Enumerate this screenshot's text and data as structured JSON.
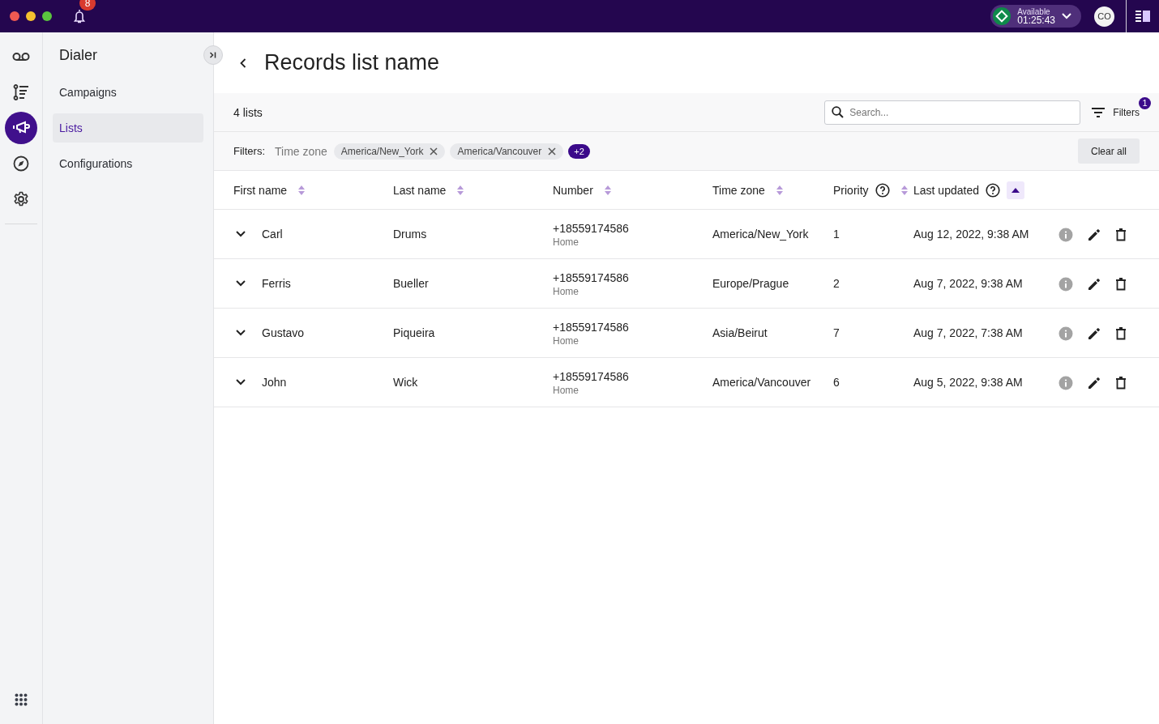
{
  "topbar": {
    "notification_count": "8",
    "status": {
      "label": "Available",
      "timer": "01:25:43"
    },
    "avatar": "CO"
  },
  "rail": [
    {
      "kind": "voicemail",
      "selected": false
    },
    {
      "kind": "list",
      "selected": false
    },
    {
      "kind": "campaign",
      "selected": true
    },
    {
      "kind": "compass",
      "selected": false
    },
    {
      "kind": "settings",
      "selected": false
    }
  ],
  "sidebar": {
    "title": "Dialer",
    "items": [
      {
        "label": "Campaigns",
        "selected": false
      },
      {
        "label": "Lists",
        "selected": true
      },
      {
        "label": "Configurations",
        "selected": false
      }
    ]
  },
  "page": {
    "title": "Records list name"
  },
  "toolbar": {
    "count": "4 lists",
    "search": {
      "placeholder": "Search..."
    },
    "filters_label": "Filters",
    "filters_badge": "1"
  },
  "filter_bar": {
    "label": "Filters:",
    "field": "Time zone",
    "chips": [
      "America/New_York",
      "America/Vancouver"
    ],
    "more": "+2",
    "clear": "Clear all"
  },
  "table": {
    "columns": [
      {
        "label": "First name",
        "help": false,
        "sorted": false
      },
      {
        "label": "Last name",
        "help": false,
        "sorted": false
      },
      {
        "label": "Number",
        "help": false,
        "sorted": false
      },
      {
        "label": "Time zone",
        "help": false,
        "sorted": false
      },
      {
        "label": "Priority",
        "help": true,
        "sorted": false
      },
      {
        "label": "Last updated",
        "help": true,
        "sorted": true
      }
    ],
    "rows": [
      {
        "first": "Carl",
        "last": "Drums",
        "number": "+18559174586",
        "number_type": "Home",
        "time_zone": "America/New_York",
        "priority": "1",
        "updated": "Aug 12, 2022, 9:38 AM"
      },
      {
        "first": "Ferris",
        "last": "Bueller",
        "number": "+18559174586",
        "number_type": "Home",
        "time_zone": "Europe/Prague",
        "priority": "2",
        "updated": "Aug 7, 2022, 9:38 AM"
      },
      {
        "first": "Gustavo",
        "last": "Piqueira",
        "number": "+18559174586",
        "number_type": "Home",
        "time_zone": "Asia/Beirut",
        "priority": "7",
        "updated": "Aug 7, 2022, 7:38 AM"
      },
      {
        "first": "John",
        "last": "Wick",
        "number": "+18559174586",
        "number_type": "Home",
        "time_zone": "America/Vancouver",
        "priority": "6",
        "updated": "Aug 5, 2022, 9:38 AM"
      }
    ]
  }
}
